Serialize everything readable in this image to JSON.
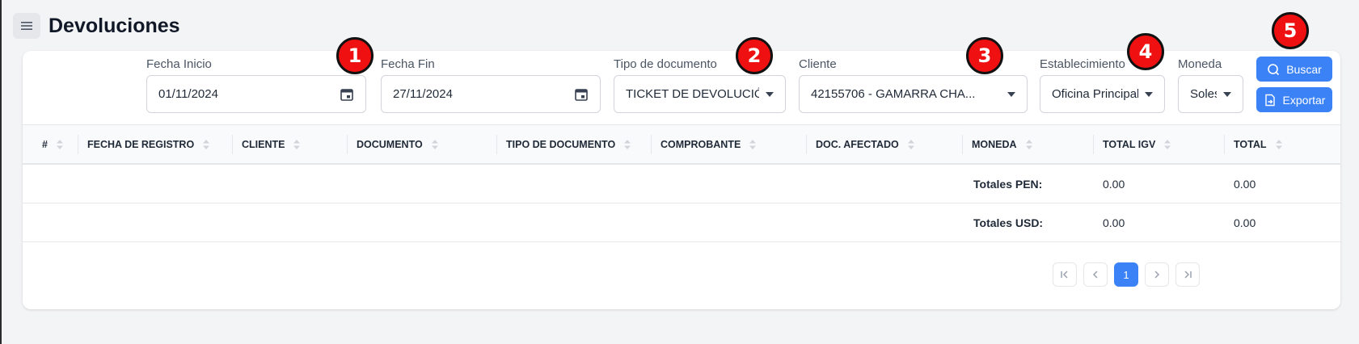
{
  "page": {
    "title": "Devoluciones"
  },
  "filters": {
    "fecha_inicio": {
      "label": "Fecha Inicio",
      "value": "01/11/2024"
    },
    "fecha_fin": {
      "label": "Fecha Fin",
      "value": "27/11/2024"
    },
    "tipo_documento": {
      "label": "Tipo de documento",
      "value": "TICKET DE DEVOLUCIÓN"
    },
    "cliente": {
      "label": "Cliente",
      "value": "42155706 - GAMARRA CHA..."
    },
    "establecimiento": {
      "label": "Establecimiento",
      "value": "Oficina Principal"
    },
    "moneda": {
      "label": "Moneda",
      "value": "Soles"
    }
  },
  "buttons": {
    "buscar": "Buscar",
    "exportar": "Exportar"
  },
  "badges": [
    "1",
    "2",
    "3",
    "4",
    "5"
  ],
  "table": {
    "columns": [
      "#",
      "FECHA DE REGISTRO",
      "CLIENTE",
      "DOCUMENTO",
      "TIPO DE DOCUMENTO",
      "COMPROBANTE",
      "DOC. AFECTADO",
      "MONEDA",
      "TOTAL IGV",
      "TOTAL"
    ],
    "totals": [
      {
        "label": "Totales PEN:",
        "igv": "0.00",
        "total": "0.00"
      },
      {
        "label": "Totales USD:",
        "igv": "0.00",
        "total": "0.00"
      }
    ]
  },
  "pagination": {
    "current": "1"
  },
  "colors": {
    "accent": "#3b82f6",
    "badge": "#ef1111"
  }
}
